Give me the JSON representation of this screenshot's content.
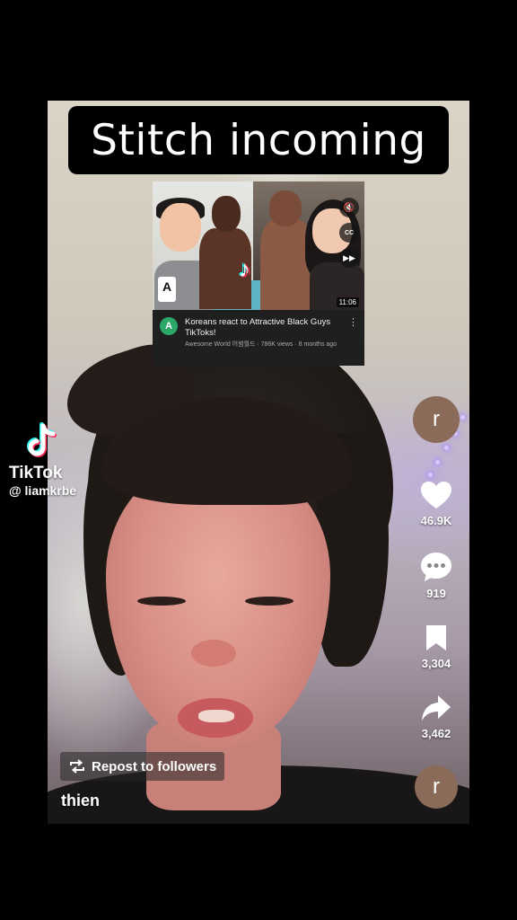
{
  "caption": {
    "text": "Stitch incoming"
  },
  "youtube_card": {
    "avatar_letter": "A",
    "badge_letter": "A",
    "title": "Koreans react to Attractive Black Guys TikToks!",
    "meta": "Awesome World 어썸월드 · 786K views · 8 months ago",
    "duration": "11:06",
    "cc_label": "CC",
    "more_glyph": "⋮",
    "mute_glyph": "🔇",
    "ff_glyph": "▶▶"
  },
  "watermark": {
    "name": "TikTok",
    "username": "@ liamkrbe"
  },
  "rail": {
    "avatar_letter_top": "r",
    "like_count": "46.9K",
    "comment_count": "919",
    "bookmark_count": "3,304",
    "share_count": "3,462",
    "avatar_letter_bottom": "r"
  },
  "repost": {
    "label": "Repost to followers"
  },
  "author": {
    "username": "thien"
  },
  "icons": {
    "like": "heart-icon",
    "comment": "comment-icon",
    "bookmark": "bookmark-icon",
    "share": "share-icon",
    "repost": "repost-icon",
    "tiktok": "tiktok-logo"
  },
  "colors": {
    "tiktok_cyan": "#25f4ee",
    "tiktok_red": "#fe2c55",
    "avatar_bg": "#8a6a58"
  }
}
